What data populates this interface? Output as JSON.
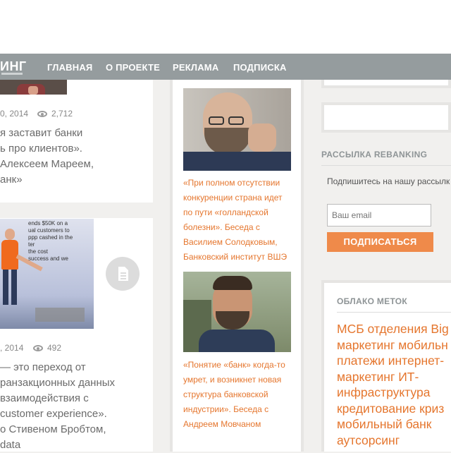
{
  "header": {
    "logo": "ИНГ",
    "nav": [
      "ГЛАВНАЯ",
      "О ПРОЕКТЕ",
      "РЕКЛАМА",
      "ПОДПИСКА"
    ]
  },
  "left": {
    "post1": {
      "date": "0, 2014",
      "views": "2,712",
      "title_lines": [
        "я заставит банки",
        "ь про клиентов».",
        "Алексеем Мареем,",
        "анк»"
      ]
    },
    "post2": {
      "date": ", 2014",
      "views": "492",
      "image_lines": [
        "ends $50K on a",
        "ual customers to",
        "ppp cashed in the",
        "ter",
        "the cost",
        "success and we"
      ],
      "title_lines": [
        "— это переход от",
        "ранзакционных данных",
        "взаимодействия с",
        " customer experience».",
        "о Стивеном Бробтом,",
        "data"
      ]
    }
  },
  "middle": {
    "interview1_lines": [
      "«При полном отсутствии",
      "конкуренции страна идет",
      "по пути «голландской",
      "болезни». Беседа с",
      "Василием Солодковым,",
      "Банковский институт ВШЭ"
    ],
    "interview2_lines": [
      "«Понятие «банк» когда-то",
      "умрет, и возникнет новая",
      "структура банковской",
      "индустрии». Беседа с",
      "Андреем Мовчаном"
    ]
  },
  "sidebar": {
    "newsletter_title": "РАССЫЛКА REBANKING",
    "newsletter_text": "Подпишитесь на нашу рассылк",
    "email_placeholder": "Ваш email",
    "subscribe_label": "ПОДПИСАТЬСЯ",
    "tags_title": "ОБЛАКО МЕТОК",
    "tags_lines": [
      "МСБ отделения Big",
      "маркетинг мобильн",
      "платежи интернет-",
      "маркетинг ИТ-",
      "инфраструктура",
      "кредитование криз",
      "мобильный банк",
      "аутсорсинг"
    ]
  },
  "colors": {
    "accent": "#e5762e",
    "nav_bg": "#959c9e",
    "button": "#ef8a4a"
  }
}
